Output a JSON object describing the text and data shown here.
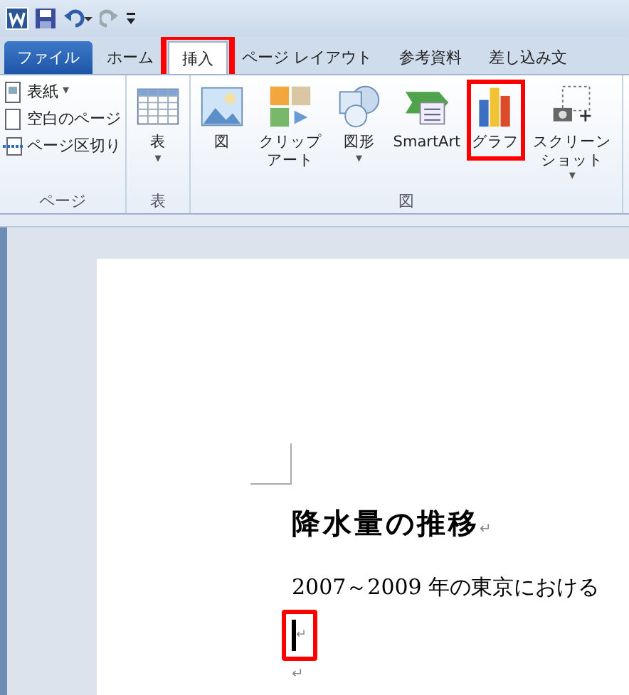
{
  "tabs": [
    {
      "label": "ファイル",
      "kind": "file",
      "selected": false,
      "highlighted": false
    },
    {
      "label": "ホーム",
      "kind": "tab",
      "selected": false,
      "highlighted": false
    },
    {
      "label": "挿入",
      "kind": "tab",
      "selected": true,
      "highlighted": true
    },
    {
      "label": "ページ レイアウト",
      "kind": "tab",
      "selected": false,
      "highlighted": false
    },
    {
      "label": "参考資料",
      "kind": "tab",
      "selected": false,
      "highlighted": false
    },
    {
      "label": "差し込み文",
      "kind": "tab",
      "selected": false,
      "highlighted": false
    }
  ],
  "ribbon_groups": [
    {
      "label": "ページ",
      "kind": "small",
      "items": [
        {
          "label": "表紙",
          "arrow": "▾"
        },
        {
          "label": "空白のページ"
        },
        {
          "label": "ページ区切り"
        }
      ]
    },
    {
      "label": "表",
      "kind": "large",
      "items": [
        {
          "label": "表",
          "arrow": "▾",
          "highlighted": false
        }
      ]
    },
    {
      "label": "図",
      "kind": "large",
      "items": [
        {
          "label": "図",
          "highlighted": false
        },
        {
          "label": "クリップアート",
          "highlighted": false
        },
        {
          "label": "図形",
          "arrow": "▾",
          "highlighted": false
        },
        {
          "label": "SmartArt",
          "highlighted": false
        },
        {
          "label": "グラフ",
          "highlighted": true
        },
        {
          "label": "スクリーンショット",
          "arrow": "▾",
          "highlighted": false
        }
      ]
    }
  ],
  "document": {
    "heading": "降水量の推移",
    "heading_mark": "↵",
    "body": "2007～2009 年の東京における",
    "cursor_mark": "↵",
    "cursor_highlighted": true,
    "end_mark": "↵"
  }
}
